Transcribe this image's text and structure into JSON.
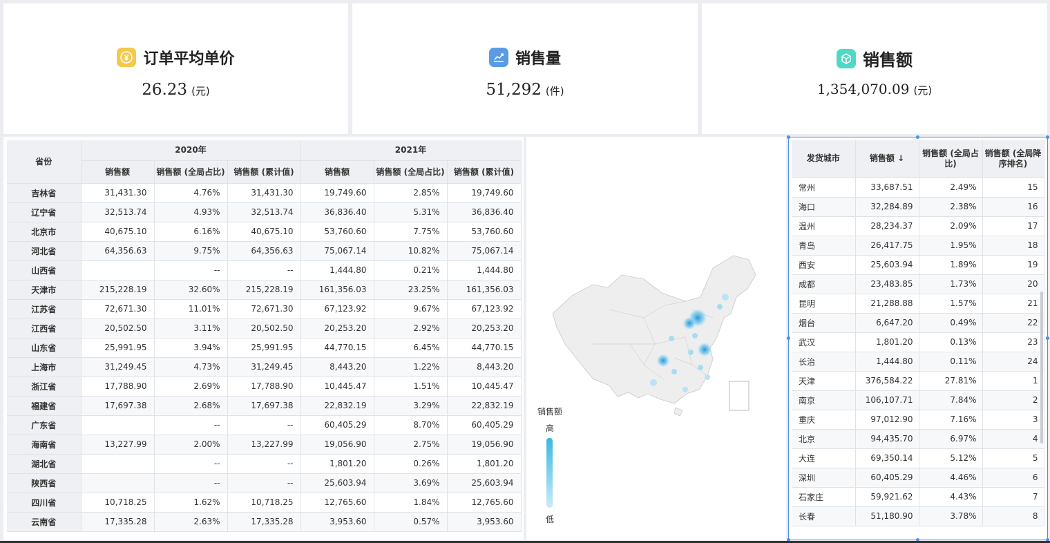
{
  "kpis": [
    {
      "title": "订单平均单价",
      "value": "26.23",
      "unit": "(元)",
      "icon": "yuan-coin-icon",
      "color": "#f3c94a"
    },
    {
      "title": "销售量",
      "value": "51,292",
      "unit": "(件)",
      "icon": "trend-chart-icon",
      "color": "#5b9be6"
    },
    {
      "title": "销售额",
      "value": "1,354,070.09",
      "unit": "(元)",
      "icon": "cube-icon",
      "color": "#4fd8c5"
    }
  ],
  "province_table": {
    "col_province": "省份",
    "year_2020": "2020年",
    "year_2021": "2021年",
    "col_sales": "销售额",
    "col_share": "销售额 (全局占比)",
    "col_cum": "销售额 (累计值)",
    "rows": [
      [
        "吉林省",
        "31,431.30",
        "4.76%",
        "31,431.30",
        "19,749.60",
        "2.85%",
        "19,749.60"
      ],
      [
        "辽宁省",
        "32,513.74",
        "4.93%",
        "32,513.74",
        "36,836.40",
        "5.31%",
        "36,836.40"
      ],
      [
        "北京市",
        "40,675.10",
        "6.16%",
        "40,675.10",
        "53,760.60",
        "7.75%",
        "53,760.60"
      ],
      [
        "河北省",
        "64,356.63",
        "9.75%",
        "64,356.63",
        "75,067.14",
        "10.82%",
        "75,067.14"
      ],
      [
        "山西省",
        "",
        "--",
        "--",
        "1,444.80",
        "0.21%",
        "1,444.80"
      ],
      [
        "天津市",
        "215,228.19",
        "32.60%",
        "215,228.19",
        "161,356.03",
        "23.25%",
        "161,356.03"
      ],
      [
        "江苏省",
        "72,671.30",
        "11.01%",
        "72,671.30",
        "67,123.92",
        "9.67%",
        "67,123.92"
      ],
      [
        "江西省",
        "20,502.50",
        "3.11%",
        "20,502.50",
        "20,253.20",
        "2.92%",
        "20,253.20"
      ],
      [
        "山东省",
        "25,991.95",
        "3.94%",
        "25,991.95",
        "44,770.15",
        "6.45%",
        "44,770.15"
      ],
      [
        "上海市",
        "31,249.45",
        "4.73%",
        "31,249.45",
        "8,443.20",
        "1.22%",
        "8,443.20"
      ],
      [
        "浙江省",
        "17,788.90",
        "2.69%",
        "17,788.90",
        "10,445.47",
        "1.51%",
        "10,445.47"
      ],
      [
        "福建省",
        "17,697.38",
        "2.68%",
        "17,697.38",
        "22,832.19",
        "3.29%",
        "22,832.19"
      ],
      [
        "广东省",
        "",
        "--",
        "--",
        "60,405.29",
        "8.70%",
        "60,405.29"
      ],
      [
        "海南省",
        "13,227.99",
        "2.00%",
        "13,227.99",
        "19,056.90",
        "2.75%",
        "19,056.90"
      ],
      [
        "湖北省",
        "",
        "--",
        "--",
        "1,801.20",
        "0.26%",
        "1,801.20"
      ],
      [
        "陕西省",
        "",
        "--",
        "--",
        "25,603.94",
        "3.69%",
        "25,603.94"
      ],
      [
        "四川省",
        "10,718.25",
        "1.62%",
        "10,718.25",
        "12,765.60",
        "1.84%",
        "12,765.60"
      ],
      [
        "云南省",
        "17,335.28",
        "2.63%",
        "17,335.28",
        "3,953.60",
        "0.57%",
        "3,953.60"
      ]
    ]
  },
  "map": {
    "legend_title": "销售额",
    "legend_high": "高",
    "legend_low": "低",
    "colors": {
      "high": "#3bb8e0",
      "low": "#c8ecf8",
      "land": "#eeeeee",
      "border": "#cccccc"
    }
  },
  "city_table": {
    "col_city": "发货城市",
    "col_sales": "销售额",
    "sort_indicator": "↓",
    "col_share": "销售额 (全局占比)",
    "col_rank": "销售额 (全局降序排名)",
    "rows": [
      [
        "常州",
        "33,687.51",
        "2.49%",
        "15"
      ],
      [
        "海口",
        "32,284.89",
        "2.38%",
        "16"
      ],
      [
        "温州",
        "28,234.37",
        "2.09%",
        "17"
      ],
      [
        "青岛",
        "26,417.75",
        "1.95%",
        "18"
      ],
      [
        "西安",
        "25,603.94",
        "1.89%",
        "19"
      ],
      [
        "成都",
        "23,483.85",
        "1.73%",
        "20"
      ],
      [
        "昆明",
        "21,288.88",
        "1.57%",
        "21"
      ],
      [
        "烟台",
        "6,647.20",
        "0.49%",
        "22"
      ],
      [
        "武汉",
        "1,801.20",
        "0.13%",
        "23"
      ],
      [
        "长治",
        "1,444.80",
        "0.11%",
        "24"
      ],
      [
        "天津",
        "376,584.22",
        "27.81%",
        "1"
      ],
      [
        "南京",
        "106,107.71",
        "7.84%",
        "2"
      ],
      [
        "重庆",
        "97,012.90",
        "7.16%",
        "3"
      ],
      [
        "北京",
        "94,435.70",
        "6.97%",
        "4"
      ],
      [
        "大连",
        "69,350.14",
        "5.12%",
        "5"
      ],
      [
        "深圳",
        "60,405.29",
        "4.46%",
        "6"
      ],
      [
        "石家庄",
        "59,921.62",
        "4.43%",
        "7"
      ],
      [
        "长春",
        "51,180.90",
        "3.78%",
        "8"
      ]
    ]
  }
}
